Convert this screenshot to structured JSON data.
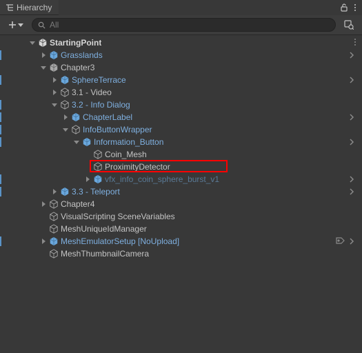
{
  "panel": {
    "title": "Hierarchy"
  },
  "search": {
    "placeholder": "All"
  },
  "rows": [
    {
      "label": "StartingPoint",
      "bold": true,
      "prefab": false,
      "depth": 2,
      "arrow": "down",
      "cube": "scene",
      "conn": false,
      "chev": false,
      "kebab": true,
      "tag": false,
      "dim": false
    },
    {
      "label": "Grasslands",
      "bold": false,
      "prefab": true,
      "depth": 3,
      "arrow": "right",
      "cube": "prefab",
      "conn": true,
      "chev": true,
      "kebab": false,
      "tag": false,
      "dim": false
    },
    {
      "label": "Chapter3",
      "bold": false,
      "prefab": false,
      "depth": 3,
      "arrow": "down",
      "cube": "solid",
      "conn": false,
      "chev": false,
      "kebab": false,
      "tag": false,
      "dim": false
    },
    {
      "label": "SphereTerrace",
      "bold": false,
      "prefab": true,
      "depth": 4,
      "arrow": "right",
      "cube": "prefab",
      "conn": true,
      "chev": true,
      "kebab": false,
      "tag": false,
      "dim": false
    },
    {
      "label": "3.1 - Video",
      "bold": false,
      "prefab": false,
      "depth": 4,
      "arrow": "right",
      "cube": "outline",
      "conn": false,
      "chev": false,
      "kebab": false,
      "tag": false,
      "dim": false
    },
    {
      "label": "3.2 - Info Dialog",
      "bold": false,
      "prefab": true,
      "depth": 4,
      "arrow": "down",
      "cube": "outline",
      "conn": true,
      "chev": false,
      "kebab": false,
      "tag": false,
      "dim": false
    },
    {
      "label": "ChapterLabel",
      "bold": false,
      "prefab": true,
      "depth": 5,
      "arrow": "right",
      "cube": "prefab",
      "conn": true,
      "chev": true,
      "kebab": false,
      "tag": false,
      "dim": false
    },
    {
      "label": "InfoButtonWrapper",
      "bold": false,
      "prefab": true,
      "depth": 5,
      "arrow": "down",
      "cube": "outline",
      "conn": true,
      "chev": false,
      "kebab": false,
      "tag": false,
      "dim": false
    },
    {
      "label": "Information_Button",
      "bold": false,
      "prefab": true,
      "depth": 6,
      "arrow": "down",
      "cube": "prefab",
      "conn": true,
      "chev": true,
      "kebab": false,
      "tag": false,
      "dim": false
    },
    {
      "label": "Coin_Mesh",
      "bold": false,
      "prefab": false,
      "depth": 7,
      "arrow": "none",
      "cube": "outline",
      "conn": false,
      "chev": false,
      "kebab": false,
      "tag": false,
      "dim": false
    },
    {
      "label": "ProximityDetector",
      "bold": false,
      "prefab": false,
      "depth": 7,
      "arrow": "none",
      "cube": "outline",
      "conn": false,
      "chev": false,
      "kebab": false,
      "tag": false,
      "dim": false,
      "highlight": true
    },
    {
      "label": "vfx_info_coin_sphere_burst_v1",
      "bold": false,
      "prefab": true,
      "depth": 7,
      "arrow": "right",
      "cube": "prefab",
      "conn": true,
      "chev": true,
      "kebab": false,
      "tag": false,
      "dim": true
    },
    {
      "label": "3.3 - Teleport",
      "bold": false,
      "prefab": true,
      "depth": 4,
      "arrow": "right",
      "cube": "prefab",
      "conn": true,
      "chev": true,
      "kebab": false,
      "tag": false,
      "dim": false
    },
    {
      "label": "Chapter4",
      "bold": false,
      "prefab": false,
      "depth": 3,
      "arrow": "right",
      "cube": "outline",
      "conn": false,
      "chev": false,
      "kebab": false,
      "tag": false,
      "dim": false
    },
    {
      "label": "VisualScripting SceneVariables",
      "bold": false,
      "prefab": false,
      "depth": 3,
      "arrow": "none",
      "cube": "outline",
      "conn": false,
      "chev": false,
      "kebab": false,
      "tag": false,
      "dim": false
    },
    {
      "label": "MeshUniqueIdManager",
      "bold": false,
      "prefab": false,
      "depth": 3,
      "arrow": "none",
      "cube": "outline",
      "conn": false,
      "chev": false,
      "kebab": false,
      "tag": false,
      "dim": false
    },
    {
      "label": "MeshEmulatorSetup [NoUpload]",
      "bold": false,
      "prefab": true,
      "depth": 3,
      "arrow": "right",
      "cube": "prefab",
      "conn": true,
      "chev": true,
      "kebab": false,
      "tag": true,
      "dim": false
    },
    {
      "label": "MeshThumbnailCamera",
      "bold": false,
      "prefab": false,
      "depth": 3,
      "arrow": "none",
      "cube": "outline",
      "conn": false,
      "chev": false,
      "kebab": false,
      "tag": false,
      "dim": false
    }
  ],
  "colors": {
    "prefab": "#7fb0e0",
    "normal": "#c4c4c4",
    "highlight": "#ff0000",
    "connector": "#5a93c8"
  }
}
